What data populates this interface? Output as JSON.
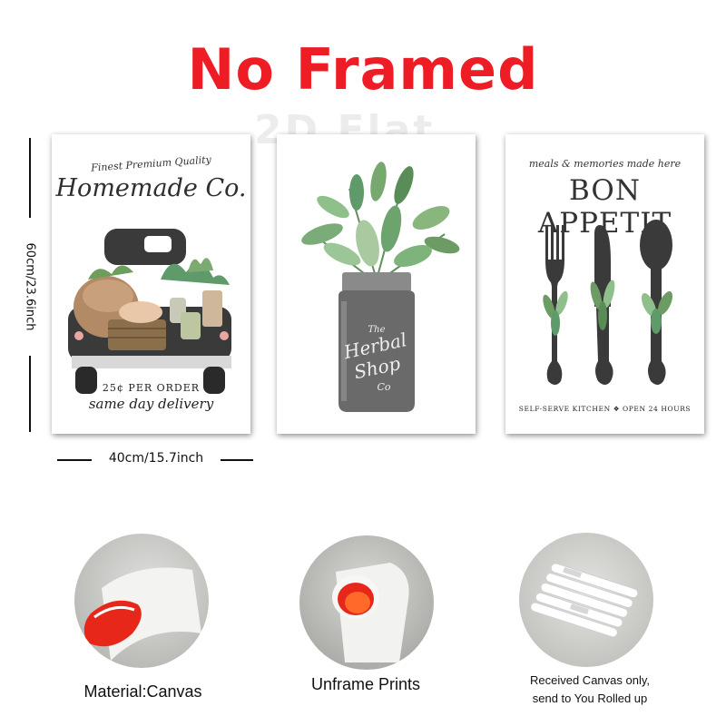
{
  "header": {
    "title": "No Framed",
    "watermark": "2D Flat"
  },
  "dimensions": {
    "height_label": "60cm/23.6inch",
    "width_label": "40cm/15.7inch"
  },
  "prints": [
    {
      "subtitle": "Finest Premium Quality",
      "title": "Homemade Co.",
      "price_text": "25¢ PER ORDER",
      "tagline": "same day delivery"
    },
    {
      "jar_line1": "The",
      "jar_line2": "Herbal",
      "jar_line3": "Shop",
      "jar_line4": "Co"
    },
    {
      "tagline": "meals & memories made here",
      "title": "BON APPETIT",
      "footer": "SELF-SERVE KITCHEN ❖ OPEN 24 HOURS"
    }
  ],
  "features": [
    {
      "caption": "Material:Canvas"
    },
    {
      "caption": "Unframe  Prints"
    },
    {
      "caption_line1": "Received Canvas only,",
      "caption_line2": "send to You Rolled up"
    }
  ],
  "colors": {
    "title_red": "#ee1c25",
    "truck_dark": "#3a3a3a",
    "leaf_green": "#5f9a6a",
    "canvas_red": "#e8271b"
  }
}
